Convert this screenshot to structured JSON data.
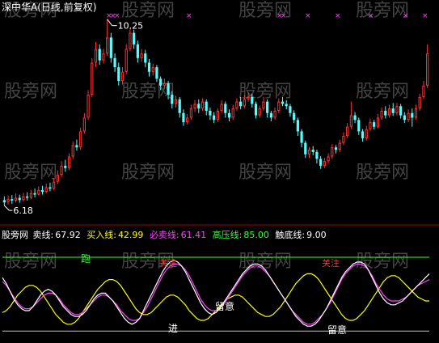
{
  "title": "深中华A(日线,前复权)",
  "watermark_text": "股旁网",
  "colors": {
    "up": "#ff3232",
    "down": "#54ffff",
    "separator": "#b00000",
    "title": "#ffffff",
    "line_sell": "#ffffff",
    "line_buy": "#ffff00",
    "line_must_sell": "#ff44ff",
    "line_high": "#33ff33",
    "line_bottom": "#c0c0c0",
    "watermark": "#5a5a5a",
    "marker_pink": "#ff44ff",
    "label_run": "#33ff33",
    "label_attention": "#ff3030",
    "label_white": "#ffffff"
  },
  "price_annotations": {
    "high_label": "10.25",
    "low_label": "6.18"
  },
  "indicator_header": {
    "name": "股旁网",
    "items": [
      {
        "label": "卖线:",
        "value": "67.92",
        "color": "#ffffff"
      },
      {
        "label": "买入线:",
        "value": "42.99",
        "color": "#ffff00"
      },
      {
        "label": "必卖线:",
        "value": "61.41",
        "color": "#ff44ff"
      },
      {
        "label": "高压线:",
        "value": "85.00",
        "color": "#33ff33"
      },
      {
        "label": "触底线:",
        "value": "9.00",
        "color": "#ffffff"
      }
    ]
  },
  "signal_labels": {
    "run": "跑",
    "attention": "关注",
    "enter": "进",
    "stay": "留意"
  },
  "chart_data": [
    {
      "type": "candlestick",
      "title": "深中华A(日线,前复权)",
      "annotations": {
        "max": 10.25,
        "min": 6.18
      },
      "ylim": [
        5.9,
        10.35
      ],
      "candles": [
        [
          6.3,
          6.25,
          6.38,
          6.18
        ],
        [
          6.26,
          6.32,
          6.4,
          6.2
        ],
        [
          6.32,
          6.29,
          6.41,
          6.22
        ],
        [
          6.29,
          6.35,
          6.44,
          6.25
        ],
        [
          6.35,
          6.3,
          6.42,
          6.24
        ],
        [
          6.3,
          6.38,
          6.46,
          6.27
        ],
        [
          6.38,
          6.35,
          6.47,
          6.29
        ],
        [
          6.35,
          6.45,
          6.52,
          6.32
        ],
        [
          6.45,
          6.42,
          6.55,
          6.36
        ],
        [
          6.42,
          6.52,
          6.6,
          6.4
        ],
        [
          6.52,
          6.48,
          6.61,
          6.42
        ],
        [
          6.48,
          6.58,
          6.66,
          6.45
        ],
        [
          6.58,
          6.55,
          6.68,
          6.49
        ],
        [
          6.55,
          6.7,
          6.78,
          6.52
        ],
        [
          6.7,
          6.85,
          6.95,
          6.65
        ],
        [
          6.85,
          7.05,
          7.15,
          6.8
        ],
        [
          7.05,
          7.0,
          7.18,
          6.92
        ],
        [
          7.0,
          7.25,
          7.32,
          6.95
        ],
        [
          7.25,
          7.5,
          7.58,
          7.2
        ],
        [
          7.5,
          7.45,
          7.62,
          7.38
        ],
        [
          7.45,
          7.8,
          7.88,
          7.4
        ],
        [
          7.8,
          8.1,
          8.2,
          7.75
        ],
        [
          8.1,
          8.6,
          8.7,
          8.05
        ],
        [
          8.6,
          9.3,
          9.4,
          8.55
        ],
        [
          9.3,
          9.6,
          9.75,
          9.2
        ],
        [
          9.6,
          9.35,
          9.7,
          9.25
        ],
        [
          9.35,
          9.5,
          9.6,
          9.28
        ],
        [
          9.5,
          9.85,
          10.25,
          9.45
        ],
        [
          9.85,
          9.4,
          9.95,
          9.3
        ],
        [
          9.4,
          9.2,
          9.5,
          9.1
        ],
        [
          9.2,
          8.9,
          9.3,
          8.8
        ],
        [
          8.9,
          9.1,
          9.2,
          8.82
        ],
        [
          9.1,
          9.6,
          9.7,
          9.05
        ],
        [
          9.6,
          9.95,
          10.05,
          9.55
        ],
        [
          9.95,
          9.7,
          10.02,
          9.6
        ],
        [
          9.7,
          9.4,
          9.78,
          9.3
        ],
        [
          9.4,
          9.5,
          9.6,
          9.32
        ],
        [
          9.5,
          9.3,
          9.58,
          9.2
        ],
        [
          9.3,
          9.1,
          9.38,
          9.0
        ],
        [
          9.1,
          9.2,
          9.28,
          9.02
        ],
        [
          9.2,
          8.95,
          9.25,
          8.88
        ],
        [
          8.95,
          8.8,
          9.0,
          8.7
        ],
        [
          8.8,
          8.85,
          8.95,
          8.72
        ],
        [
          8.85,
          8.6,
          8.9,
          8.5
        ],
        [
          8.6,
          8.4,
          8.68,
          8.3
        ],
        [
          8.4,
          8.5,
          8.58,
          8.32
        ],
        [
          8.5,
          8.2,
          8.55,
          8.1
        ],
        [
          8.2,
          8.0,
          8.28,
          7.92
        ],
        [
          8.0,
          8.1,
          8.18,
          7.95
        ],
        [
          8.1,
          8.3,
          8.38,
          8.05
        ],
        [
          8.3,
          8.4,
          8.48,
          8.22
        ],
        [
          8.4,
          8.3,
          8.5,
          8.2
        ],
        [
          8.3,
          8.45,
          8.52,
          8.25
        ],
        [
          8.45,
          8.25,
          8.5,
          8.15
        ],
        [
          8.25,
          8.15,
          8.32,
          8.05
        ],
        [
          8.15,
          8.05,
          8.22,
          7.98
        ],
        [
          8.05,
          8.25,
          8.3,
          8.0
        ],
        [
          8.25,
          8.4,
          8.48,
          8.2
        ],
        [
          8.4,
          8.2,
          8.45,
          8.1
        ],
        [
          8.2,
          8.1,
          8.28,
          8.02
        ],
        [
          8.1,
          8.3,
          8.38,
          8.05
        ],
        [
          8.3,
          8.45,
          8.52,
          8.25
        ],
        [
          8.45,
          8.35,
          8.55,
          8.28
        ],
        [
          8.35,
          8.5,
          8.6,
          8.3
        ],
        [
          8.5,
          8.55,
          8.65,
          8.45
        ],
        [
          8.55,
          8.4,
          8.62,
          8.32
        ],
        [
          8.4,
          8.15,
          8.45,
          8.08
        ],
        [
          8.15,
          8.3,
          8.36,
          8.1
        ],
        [
          8.3,
          8.45,
          8.55,
          8.25
        ],
        [
          8.45,
          8.2,
          8.5,
          8.1
        ],
        [
          8.2,
          8.1,
          8.25,
          8.02
        ],
        [
          8.1,
          8.25,
          8.32,
          8.05
        ],
        [
          8.25,
          8.45,
          8.52,
          8.2
        ],
        [
          8.45,
          8.4,
          8.55,
          8.35
        ],
        [
          8.4,
          8.35,
          8.48,
          8.28
        ],
        [
          8.35,
          8.2,
          8.4,
          8.12
        ],
        [
          8.2,
          8.05,
          8.26,
          7.98
        ],
        [
          8.05,
          7.8,
          8.1,
          7.7
        ],
        [
          7.8,
          7.55,
          7.85,
          7.45
        ],
        [
          7.55,
          7.3,
          7.6,
          7.22
        ],
        [
          7.3,
          7.4,
          7.46,
          7.22
        ],
        [
          7.4,
          7.35,
          7.48,
          7.28
        ],
        [
          7.35,
          7.2,
          7.4,
          7.1
        ],
        [
          7.2,
          7.05,
          7.26,
          6.98
        ],
        [
          7.05,
          7.15,
          7.22,
          7.0
        ],
        [
          7.15,
          7.25,
          7.32,
          7.1
        ],
        [
          7.25,
          7.45,
          7.52,
          7.2
        ],
        [
          7.45,
          7.4,
          7.5,
          7.32
        ],
        [
          7.4,
          7.55,
          7.62,
          7.35
        ],
        [
          7.55,
          7.7,
          7.78,
          7.5
        ],
        [
          7.7,
          7.9,
          7.98,
          7.65
        ],
        [
          7.9,
          8.15,
          8.45,
          7.85
        ],
        [
          8.15,
          8.05,
          8.22,
          7.98
        ],
        [
          8.05,
          7.8,
          8.1,
          7.72
        ],
        [
          7.8,
          7.65,
          7.85,
          7.58
        ],
        [
          7.65,
          7.85,
          7.92,
          7.6
        ],
        [
          7.85,
          8.0,
          8.08,
          7.8
        ],
        [
          8.0,
          7.9,
          8.05,
          7.84
        ],
        [
          7.9,
          8.1,
          8.18,
          7.86
        ],
        [
          8.1,
          8.25,
          8.32,
          8.05
        ],
        [
          8.25,
          8.15,
          8.35,
          8.08
        ],
        [
          8.15,
          8.3,
          8.38,
          8.1
        ],
        [
          8.3,
          8.2,
          8.42,
          8.14
        ],
        [
          8.2,
          8.35,
          8.42,
          8.15
        ],
        [
          8.35,
          8.15,
          8.4,
          8.08
        ],
        [
          8.15,
          8.05,
          8.22,
          7.98
        ],
        [
          8.05,
          8.2,
          8.28,
          8.0
        ],
        [
          8.2,
          8.1,
          8.3,
          7.9
        ],
        [
          8.1,
          8.3,
          8.38,
          8.05
        ],
        [
          8.3,
          8.55,
          8.62,
          8.25
        ],
        [
          8.55,
          8.8,
          8.9,
          8.5
        ],
        [
          8.8,
          9.5,
          9.7,
          8.75
        ]
      ]
    },
    {
      "type": "line",
      "title": "股旁网",
      "ylim": [
        0,
        100
      ],
      "hlines": [
        {
          "name": "高压线",
          "value": 85
        },
        {
          "name": "触底线",
          "value": 9
        }
      ],
      "series": [
        {
          "name": "卖线",
          "values": [
            64,
            58,
            50,
            42,
            36,
            32,
            30,
            30,
            34,
            40,
            46,
            50,
            52,
            50,
            46,
            40,
            34,
            30,
            26,
            24,
            24,
            26,
            30,
            36,
            42,
            46,
            48,
            48,
            44,
            40,
            34,
            28,
            22,
            18,
            16,
            18,
            22,
            30,
            38,
            46,
            54,
            62,
            70,
            76,
            80,
            82,
            80,
            76,
            70,
            62,
            54,
            46,
            38,
            32,
            28,
            26,
            28,
            32,
            38,
            44,
            50,
            56,
            62,
            68,
            72,
            76,
            78,
            78,
            76,
            72,
            66,
            60,
            54,
            48,
            42,
            36,
            30,
            24,
            20,
            16,
            14,
            14,
            16,
            20,
            26,
            32,
            40,
            48,
            56,
            64,
            70,
            74,
            78,
            80,
            80,
            78,
            72,
            64,
            56,
            48,
            42,
            38,
            36,
            36,
            38,
            40,
            44,
            48,
            52,
            56,
            60,
            64,
            68
          ]
        },
        {
          "name": "买入线",
          "values": [
            28,
            30,
            34,
            40,
            46,
            50,
            54,
            56,
            56,
            54,
            50,
            44,
            38,
            32,
            26,
            22,
            18,
            16,
            16,
            18,
            22,
            28,
            34,
            40,
            46,
            52,
            56,
            60,
            62,
            62,
            60,
            56,
            50,
            44,
            38,
            32,
            28,
            26,
            26,
            28,
            32,
            36,
            40,
            44,
            46,
            46,
            44,
            40,
            36,
            30,
            26,
            22,
            20,
            20,
            22,
            26,
            30,
            34,
            38,
            42,
            44,
            46,
            46,
            44,
            40,
            36,
            32,
            28,
            26,
            24,
            24,
            26,
            30,
            34,
            40,
            46,
            52,
            58,
            62,
            66,
            68,
            68,
            66,
            62,
            56,
            50,
            44,
            38,
            32,
            26,
            22,
            20,
            20,
            22,
            26,
            30,
            36,
            42,
            48,
            54,
            60,
            64,
            66,
            66,
            64,
            60,
            56,
            52,
            48,
            44,
            42,
            40,
            40
          ]
        },
        {
          "name": "必卖线",
          "values": [
            60,
            56,
            50,
            44,
            38,
            34,
            32,
            32,
            34,
            38,
            42,
            46,
            48,
            48,
            46,
            42,
            36,
            32,
            28,
            26,
            26,
            28,
            32,
            36,
            40,
            44,
            46,
            46,
            44,
            40,
            36,
            30,
            26,
            22,
            20,
            20,
            22,
            28,
            34,
            42,
            50,
            58,
            66,
            72,
            76,
            78,
            78,
            76,
            72,
            66,
            58,
            50,
            42,
            36,
            32,
            30,
            30,
            32,
            36,
            42,
            48,
            54,
            60,
            66,
            70,
            74,
            76,
            76,
            74,
            70,
            66,
            60,
            54,
            48,
            42,
            36,
            30,
            26,
            22,
            18,
            16,
            16,
            18,
            22,
            26,
            32,
            38,
            46,
            54,
            62,
            68,
            72,
            76,
            78,
            78,
            76,
            72,
            66,
            58,
            52,
            46,
            42,
            40,
            40,
            40,
            42,
            44,
            48,
            52,
            56,
            58,
            60,
            62
          ]
        }
      ]
    }
  ]
}
